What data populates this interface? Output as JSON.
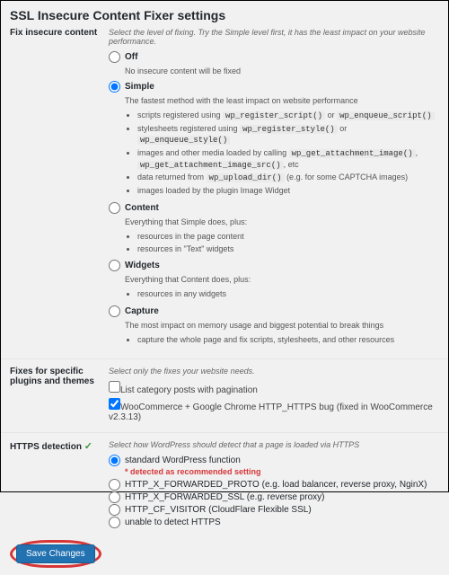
{
  "title": "SSL Insecure Content Fixer settings",
  "fix": {
    "label": "Fix insecure content",
    "hint": "Select the level of fixing. Try the Simple level first, it has the least impact on your website performance.",
    "off": {
      "name": "Off",
      "desc": "No insecure content will be fixed"
    },
    "simple": {
      "name": "Simple",
      "desc": "The fastest method with the least impact on website performance",
      "b1a": "scripts registered using ",
      "b1c1": "wp_register_script()",
      "b1b": " or ",
      "b1c2": "wp_enqueue_script()",
      "b2a": "stylesheets registered using ",
      "b2c1": "wp_register_style()",
      "b2b": " or ",
      "b2c2": "wp_enqueue_style()",
      "b3a": "images and other media loaded by calling ",
      "b3c1": "wp_get_attachment_image()",
      "b3b": ", ",
      "b3c2": "wp_get_attachment_image_src()",
      "b3c": ", etc",
      "b4a": "data returned from ",
      "b4c1": "wp_upload_dir()",
      "b4b": " (e.g. for some CAPTCHA images)",
      "b5": "images loaded by the plugin Image Widget"
    },
    "content": {
      "name": "Content",
      "desc": "Everything that Simple does, plus:",
      "b1": "resources in the page content",
      "b2": "resources in \"Text\" widgets"
    },
    "widgets": {
      "name": "Widgets",
      "desc": "Everything that Content does, plus:",
      "b1": "resources in any widgets"
    },
    "capture": {
      "name": "Capture",
      "desc": "The most impact on memory usage and biggest potential to break things",
      "b1": "capture the whole page and fix scripts, stylesheets, and other resources"
    }
  },
  "plugins": {
    "label": "Fixes for specific plugins and themes",
    "hint": "Select only the fixes your website needs.",
    "cb1": "List category posts with pagination",
    "cb2": "WooCommerce + Google Chrome HTTP_HTTPS bug (fixed in WooCommerce v2.3.13)"
  },
  "https": {
    "label": "HTTPS detection",
    "hint": "Select how WordPress should detect that a page is loaded via HTTPS",
    "detected": "* detected as recommended setting",
    "o1": "standard WordPress function",
    "o2": "HTTP_X_FORWARDED_PROTO (e.g. load balancer, reverse proxy, NginX)",
    "o3": "HTTP_X_FORWARDED_SSL (e.g. reverse proxy)",
    "o4": "HTTP_CF_VISITOR (CloudFlare Flexible SSL)",
    "o5": "unable to detect HTTPS"
  },
  "save": "Save Changes"
}
